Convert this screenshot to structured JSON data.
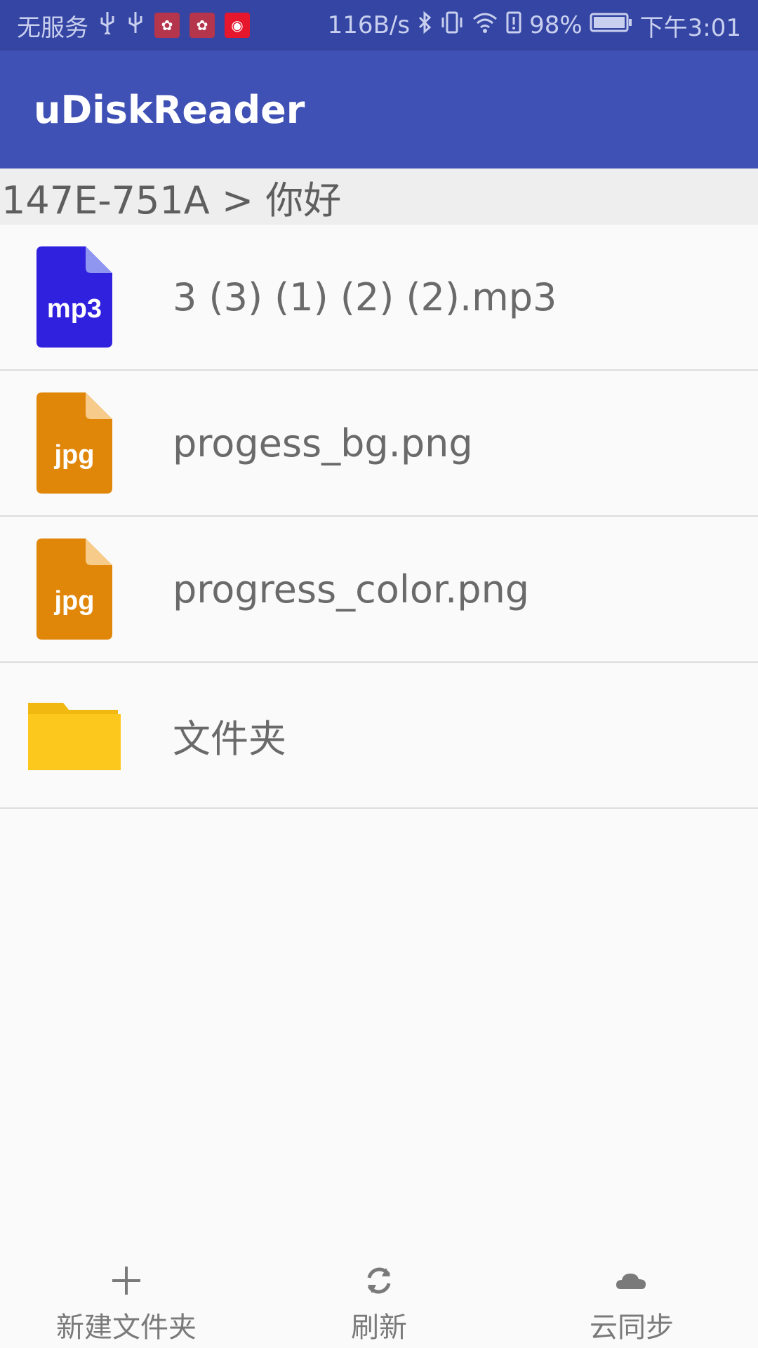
{
  "status_bar": {
    "carrier": "无服务",
    "speed": "116B/s",
    "battery": "98%",
    "time": "下午3:01"
  },
  "app_bar": {
    "title": "uDiskReader"
  },
  "breadcrumb": {
    "path": "147E-751A > 你好"
  },
  "files": [
    {
      "name": "3 (3) (1) (2) (2).mp3",
      "icon_label": "mp3",
      "color": "#3021de"
    },
    {
      "name": "progess_bg.png",
      "icon_label": "jpg",
      "color": "#e0870a"
    },
    {
      "name": "progress_color.png",
      "icon_label": "jpg",
      "color": "#e0870a"
    },
    {
      "name": "文件夹",
      "icon": "folder-icon",
      "color": "#fcc81e"
    }
  ],
  "bottom_actions": [
    {
      "label": "新建文件夹",
      "icon": "plus-icon"
    },
    {
      "label": "刷新",
      "icon": "refresh-icon"
    },
    {
      "label": "云同步",
      "icon": "cloud-icon"
    }
  ]
}
